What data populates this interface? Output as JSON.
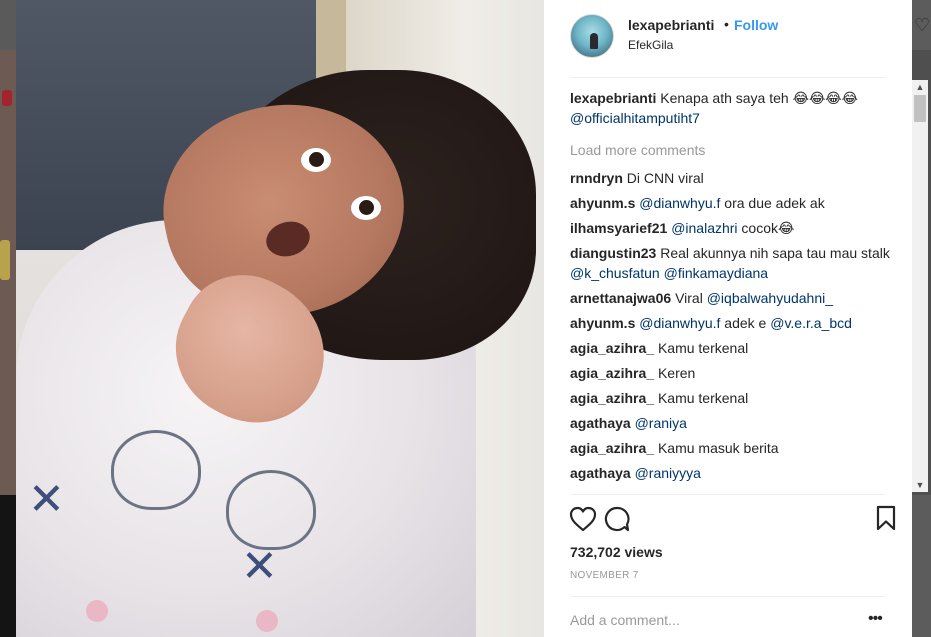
{
  "post": {
    "username": "lexapebrianti",
    "separator": "•",
    "follow_label": "Follow",
    "location": "EfekGila",
    "caption_user": "lexapebrianti",
    "caption_text": "Kenapa ath saya teh 😂😂😂😂",
    "caption_mention": "@officialhitamputiht7",
    "load_more": "Load more comments",
    "views": "732,702 views",
    "date": "NOVEMBER 7",
    "add_comment_placeholder": "Add a comment...",
    "more_options": "•••"
  },
  "comments": [
    {
      "user": "rnndryn",
      "parts": [
        {
          "t": "text",
          "v": "Di CNN viral"
        }
      ]
    },
    {
      "user": "ahyunm.s",
      "parts": [
        {
          "t": "mention",
          "v": "@dianwhyu.f"
        },
        {
          "t": "text",
          "v": " ora due adek ak"
        }
      ]
    },
    {
      "user": "ilhamsyarief21",
      "parts": [
        {
          "t": "mention",
          "v": "@inalazhri"
        },
        {
          "t": "text",
          "v": " cocok😂"
        }
      ]
    },
    {
      "user": "diangustin23",
      "parts": [
        {
          "t": "text",
          "v": "Real akunnya nih sapa tau mau stalk "
        },
        {
          "t": "mention",
          "v": "@k_chusfatun"
        },
        {
          "t": "text",
          "v": " "
        },
        {
          "t": "mention",
          "v": "@finkamaydiana"
        }
      ]
    },
    {
      "user": "arnettanajwa06",
      "parts": [
        {
          "t": "text",
          "v": "Viral "
        },
        {
          "t": "mention",
          "v": "@iqbalwahyudahni_"
        }
      ]
    },
    {
      "user": "ahyunm.s",
      "parts": [
        {
          "t": "mention",
          "v": "@dianwhyu.f"
        },
        {
          "t": "text",
          "v": " adek e "
        },
        {
          "t": "mention",
          "v": "@v.e.r.a_bcd"
        }
      ]
    },
    {
      "user": "agia_azihra_",
      "parts": [
        {
          "t": "text",
          "v": "Kamu terkenal"
        }
      ]
    },
    {
      "user": "agia_azihra_",
      "parts": [
        {
          "t": "text",
          "v": "Keren"
        }
      ]
    },
    {
      "user": "agia_azihra_",
      "parts": [
        {
          "t": "text",
          "v": "Kamu terkenal"
        }
      ]
    },
    {
      "user": "agathaya",
      "parts": [
        {
          "t": "mention",
          "v": "@raniya"
        }
      ]
    },
    {
      "user": "agia_azihra_",
      "parts": [
        {
          "t": "text",
          "v": "Kamu masuk berita"
        }
      ]
    },
    {
      "user": "agathaya",
      "parts": [
        {
          "t": "mention",
          "v": "@raniyyya"
        }
      ]
    }
  ],
  "icons": {
    "like": "heart-icon",
    "comment": "speech-bubble-icon",
    "save": "bookmark-icon",
    "bg_like": "heart-icon"
  },
  "colors": {
    "link": "#3897f0",
    "mention": "#003569",
    "muted": "#999999",
    "text": "#262626"
  }
}
